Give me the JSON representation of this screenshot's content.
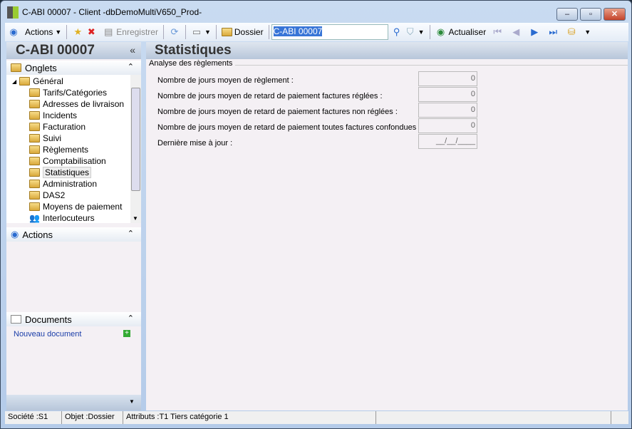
{
  "window": {
    "title": "C-ABI 00007 -  Client -dbDemoMultiV650_Prod-"
  },
  "toolbar": {
    "actions": "Actions",
    "save": "Enregistrer",
    "folder": "Dossier",
    "search_value": "C-ABI 00007",
    "refresh": "Actualiser"
  },
  "left": {
    "header": "C-ABI 00007",
    "tabs_section": "Onglets",
    "root": "Général",
    "items": [
      "Tarifs/Catégories",
      "Adresses de livraison",
      "Incidents",
      "Facturation",
      "Suivi",
      "Règlements",
      "Comptabilisation",
      "Statistiques",
      "Administration",
      "DAS2",
      "Moyens de paiement",
      "Interlocuteurs"
    ],
    "actions_section": "Actions",
    "documents_section": "Documents",
    "new_document": "Nouveau document"
  },
  "main": {
    "title": "Statistiques",
    "group": "Analyse des règlements",
    "rows": [
      {
        "label": "Nombre de jours moyen de règlement :",
        "value": "0"
      },
      {
        "label": "Nombre de jours moyen de retard de paiement factures réglées :",
        "value": "0"
      },
      {
        "label": "Nombre de jours moyen de retard de paiement factures non réglées :",
        "value": "0"
      },
      {
        "label": "Nombre de jours moyen de retard de paiement toutes factures confondues :",
        "value": "0"
      },
      {
        "label": "Dernière mise à jour :",
        "value": "__/__/____"
      }
    ]
  },
  "status": {
    "company": "Société :S1",
    "object": "Objet :Dossier",
    "attributes": "Attributs :T1 Tiers catégorie 1"
  }
}
